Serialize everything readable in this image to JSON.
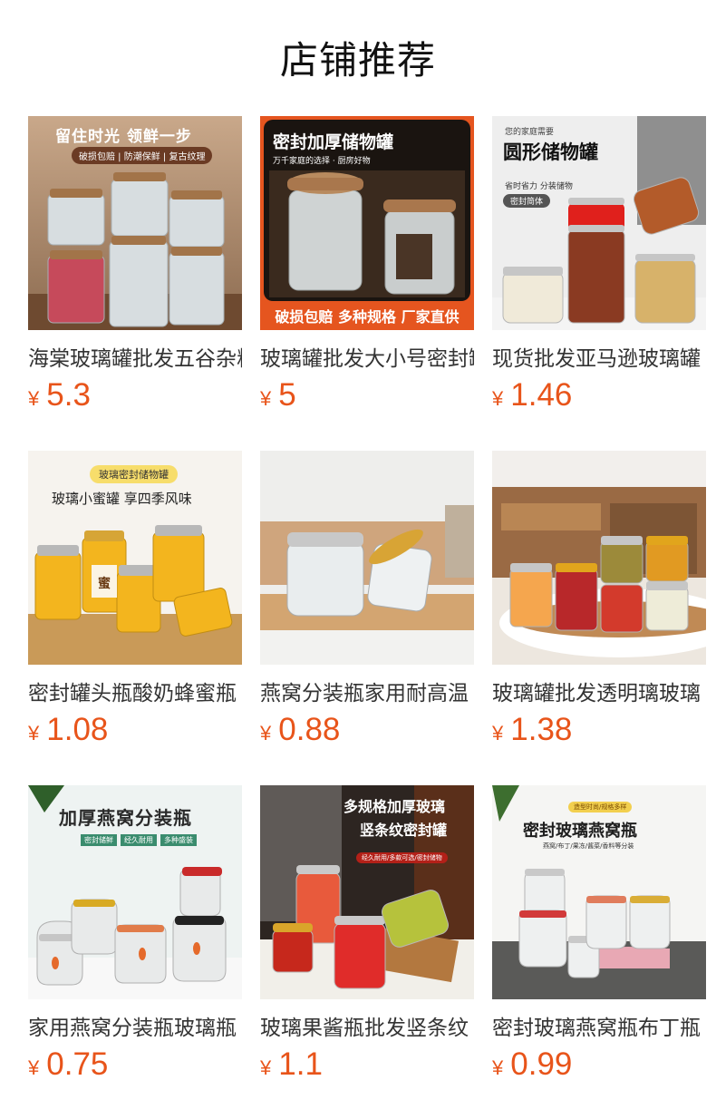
{
  "page": {
    "title": "店铺推荐"
  },
  "colors": {
    "price": "#e8541a",
    "title_text": "#333333"
  },
  "products": [
    {
      "title": "海棠玻璃罐批发五谷杂粮",
      "currency": "¥",
      "price": "5.3",
      "overlay": {
        "heading": "留住时光 领鲜一步",
        "tags": "破损包赔 | 防潮保鲜 | 复古纹理"
      }
    },
    {
      "title": "玻璃罐批发大小号密封罐",
      "currency": "¥",
      "price": "5",
      "overlay": {
        "heading": "密封加厚储物罐",
        "sub": "万千家庭的选择 · 厨房好物",
        "footer": "破损包赔 多种规格 厂家直供"
      }
    },
    {
      "title": "现货批发亚马逊玻璃罐",
      "currency": "¥",
      "price": "1.46",
      "overlay": {
        "top": "您的家庭需要",
        "heading": "圆形储物罐",
        "sub": "省时省力 分装储物",
        "badge": "密封简体"
      }
    },
    {
      "title": "密封罐头瓶酸奶蜂蜜瓶",
      "currency": "¥",
      "price": "1.08",
      "overlay": {
        "badge": "玻璃密封储物罐",
        "heading": "玻璃小蜜罐 享四季风味",
        "jar_label": "蜜"
      }
    },
    {
      "title": "燕窝分装瓶家用耐高温",
      "currency": "¥",
      "price": "0.88",
      "overlay": {}
    },
    {
      "title": "玻璃罐批发透明璃玻璃",
      "currency": "¥",
      "price": "1.38",
      "overlay": {}
    },
    {
      "title": "家用燕窝分装瓶玻璃瓶",
      "currency": "¥",
      "price": "0.75",
      "overlay": {
        "heading": "加厚燕窝分装瓶",
        "tags": [
          "密封储鲜",
          "经久耐用",
          "多种盛装"
        ]
      }
    },
    {
      "title": "玻璃果酱瓶批发竖条纹",
      "currency": "¥",
      "price": "1.1",
      "overlay": {
        "heading_1": "多规格加厚玻璃",
        "heading_2": "竖条纹密封罐",
        "sub": "经久耐用/多款可选/密封储物"
      }
    },
    {
      "title": "密封玻璃燕窝瓶布丁瓶",
      "currency": "¥",
      "price": "0.99",
      "overlay": {
        "badge": "造型时尚/规格多样",
        "heading": "密封玻璃燕窝瓶",
        "sub": "燕窝/布丁/果冻/酱菜/香料等分装"
      }
    }
  ]
}
